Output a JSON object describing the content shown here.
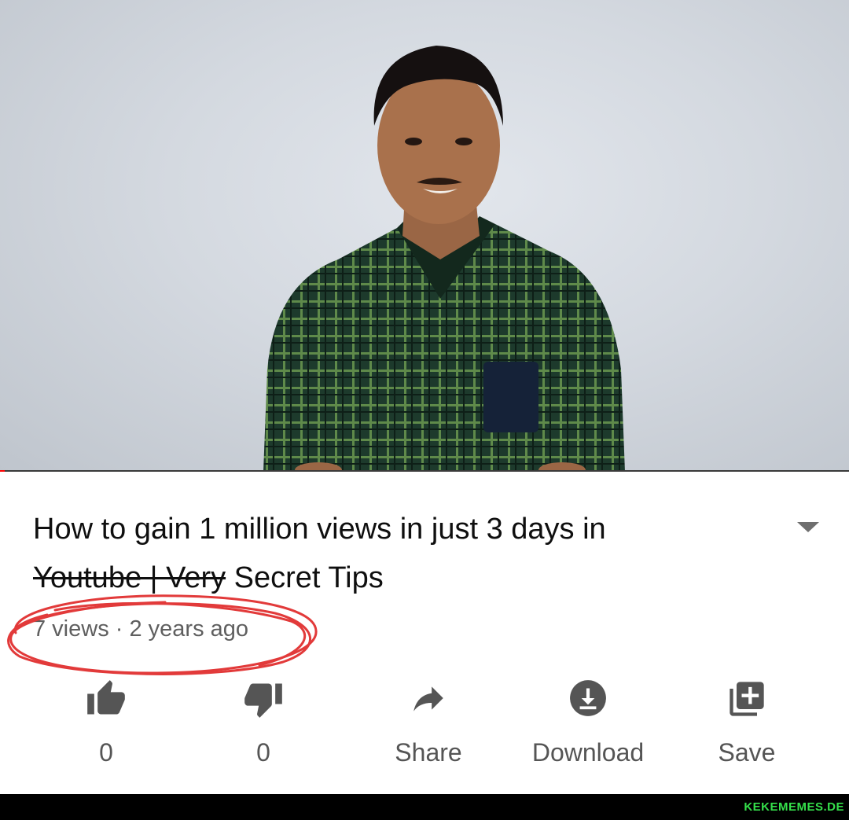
{
  "video": {
    "title_line1": "How to gain 1 million views in just 3 days in",
    "title_line2_struck": "Youtube | Very",
    "title_line2_rest": " Secret Tips",
    "views": "7 views",
    "separator": " · ",
    "age": "2 years ago",
    "progress": 0.005
  },
  "actions": {
    "like_count": "0",
    "dislike_count": "0",
    "share_label": "Share",
    "download_label": "Download",
    "save_label": "Save"
  },
  "icons": {
    "like": "thumbs-up-icon",
    "dislike": "thumbs-down-icon",
    "share": "share-arrow-icon",
    "download": "download-icon",
    "save": "playlist-add-icon",
    "expand": "chevron-down-icon"
  },
  "colors": {
    "progress": "#ff0000",
    "annotation": "#e23a3a",
    "icon": "#555555",
    "watermark": "#35e04b"
  },
  "watermark": "KEKEMEMES.DE"
}
